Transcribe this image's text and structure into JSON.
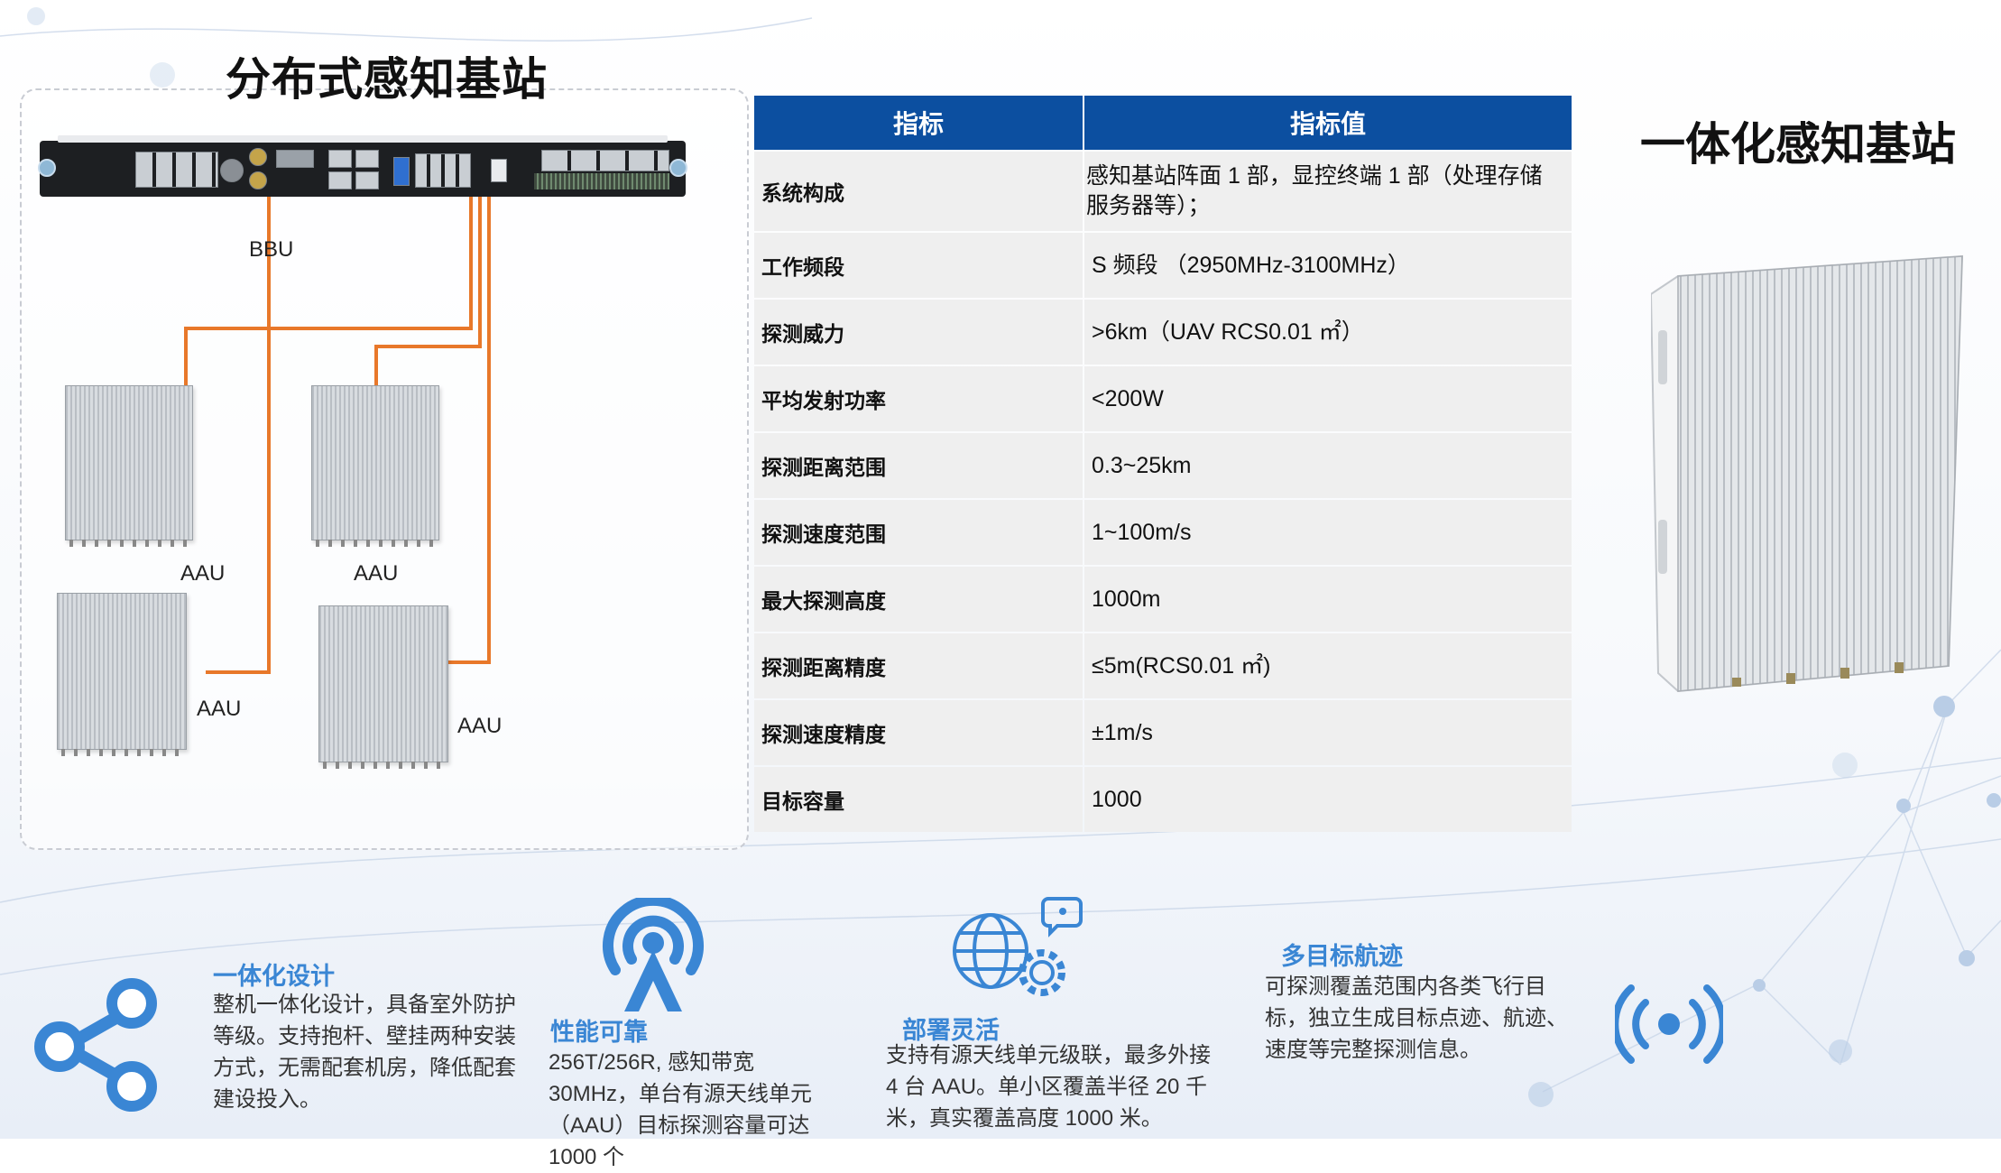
{
  "distributed": {
    "title": "分布式感知基站",
    "bbu_label": "BBU",
    "aau_labels": [
      "AAU",
      "AAU",
      "AAU",
      "AAU"
    ]
  },
  "integrated": {
    "title": "一体化感知基站"
  },
  "table": {
    "headers": [
      "指标",
      "指标值"
    ],
    "rows": [
      {
        "key": "系统构成",
        "value": "感知基站阵面 1 部，显控终端 1 部（处理存储服务器等）；"
      },
      {
        "key": "工作频段",
        "value": "S 频段 （2950MHz-3100MHz）"
      },
      {
        "key": "探测威力",
        "value": ">6km（UAV RCS0.01 ㎡）"
      },
      {
        "key": "平均发射功率",
        "value": "<200W"
      },
      {
        "key": "探测距离范围",
        "value": "0.3~25km"
      },
      {
        "key": "探测速度范围",
        "value": "1~100m/s"
      },
      {
        "key": "最大探测高度",
        "value": "1000m"
      },
      {
        "key": "探测距离精度",
        "value": "≤5m(RCS0.01 ㎡)"
      },
      {
        "key": "探测速度精度",
        "value": "±1m/s"
      },
      {
        "key": "目标容量",
        "value": "1000"
      }
    ]
  },
  "features": [
    {
      "title": "一体化设计",
      "text": "整机一体化设计，具备室外防护等级。支持抱杆、壁挂两种安装方式，无需配套机房，降低配套建设投入。",
      "icon": "share-icon"
    },
    {
      "title": "性能可靠",
      "text": "256T/256R, 感知带宽 30MHz，单台有源天线单元（AAU）目标探测容量可达 1000 个",
      "icon": "antenna-tower-icon"
    },
    {
      "title": "部署灵活",
      "text": "支持有源天线单元级联，最多外接 4 台 AAU。单小区覆盖半径 20 千米，真实覆盖高度 1000 米。",
      "icon": "globe-gear-icon"
    },
    {
      "title": "多目标航迹",
      "text": "可探测覆盖范围内各类飞行目标，独立生成目标点迹、航迹、速度等完整探测信息。",
      "icon": "broadcast-icon"
    }
  ],
  "colors": {
    "header_blue": "#0c4fa0",
    "accent_blue": "#3a86d4",
    "wire_orange": "#e8782a",
    "cell_gray": "#efefef"
  }
}
